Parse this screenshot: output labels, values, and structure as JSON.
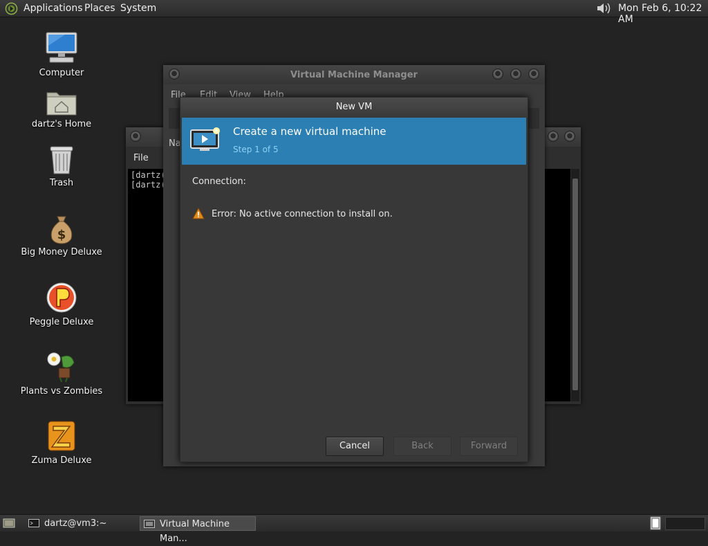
{
  "top_panel": {
    "menus": [
      "Applications",
      "Places",
      "System"
    ],
    "clock": "Mon Feb  6, 10:22 AM"
  },
  "desktop_icons": [
    {
      "label": "Computer",
      "icon": "computer-icon"
    },
    {
      "label": "dartz's Home",
      "icon": "home-folder-icon"
    },
    {
      "label": "Trash",
      "icon": "trash-icon"
    },
    {
      "label": "Big Money Deluxe",
      "icon": "money-bag-icon"
    },
    {
      "label": "Peggle Deluxe",
      "icon": "peggle-icon"
    },
    {
      "label": "Plants vs Zombies",
      "icon": "plants-vs-zombies-icon"
    },
    {
      "label": "Zuma Deluxe",
      "icon": "zuma-icon"
    }
  ],
  "terminal_window": {
    "menu": [
      "File"
    ],
    "lines": [
      "[dartz(",
      "[dartz("
    ]
  },
  "vmm_window": {
    "title": "Virtual Machine Manager",
    "menus": [
      "File",
      "Edit",
      "View",
      "Help"
    ],
    "column_header": "Na"
  },
  "new_vm_dialog": {
    "title": "New VM",
    "header_title": "Create a new virtual machine",
    "step": "Step 1 of 5",
    "connection_label": "Connection:",
    "error": "Error: No active connection to install on.",
    "buttons": {
      "cancel": "Cancel",
      "back": "Back",
      "forward": "Forward"
    }
  },
  "bottom_panel": {
    "tasks": [
      "dartz@vm3:~",
      "Virtual Machine Man..."
    ]
  },
  "colors": {
    "header_blue": "#2b7fb3",
    "step_text": "#8fd1f5",
    "warning": "#e08a1e"
  }
}
